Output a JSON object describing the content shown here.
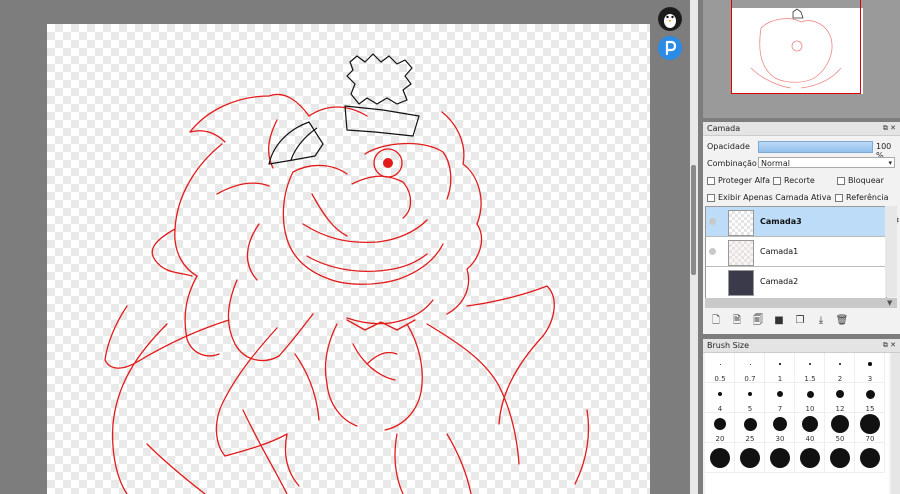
{
  "layer_panel": {
    "title": "Camada",
    "opacity_label": "Opacidade",
    "opacity_value": "100 %",
    "opacity_fraction": 1.0,
    "blend_label": "Combinação",
    "blend_value": "Normal",
    "checkboxes": {
      "protect_alpha": "Proteger Alfa",
      "clip": "Recorte",
      "lock": "Bloquear",
      "show_active": "Exibir Apenas Camada Ativa",
      "reference": "Referência"
    },
    "layers": [
      {
        "name": "Camada3",
        "selected": true
      },
      {
        "name": "Camada1",
        "selected": false
      },
      {
        "name": "Camada2",
        "selected": false
      }
    ]
  },
  "brush_panel": {
    "title": "Brush Size",
    "sizes": [
      "0.5",
      "0.7",
      "1",
      "1.5",
      "2",
      "3",
      "4",
      "5",
      "7",
      "10",
      "12",
      "15",
      "20",
      "25",
      "30",
      "40",
      "50",
      "70",
      "",
      "",
      "",
      "",
      "",
      ""
    ]
  },
  "icons": {
    "float_top": "penguin-icon",
    "float_bottom": "p-logo-icon",
    "settings": "gear-icon"
  },
  "colors": {
    "stroke": "#e31b1b",
    "accent": "#2b8ce8",
    "selection": "#bcdcf7"
  }
}
